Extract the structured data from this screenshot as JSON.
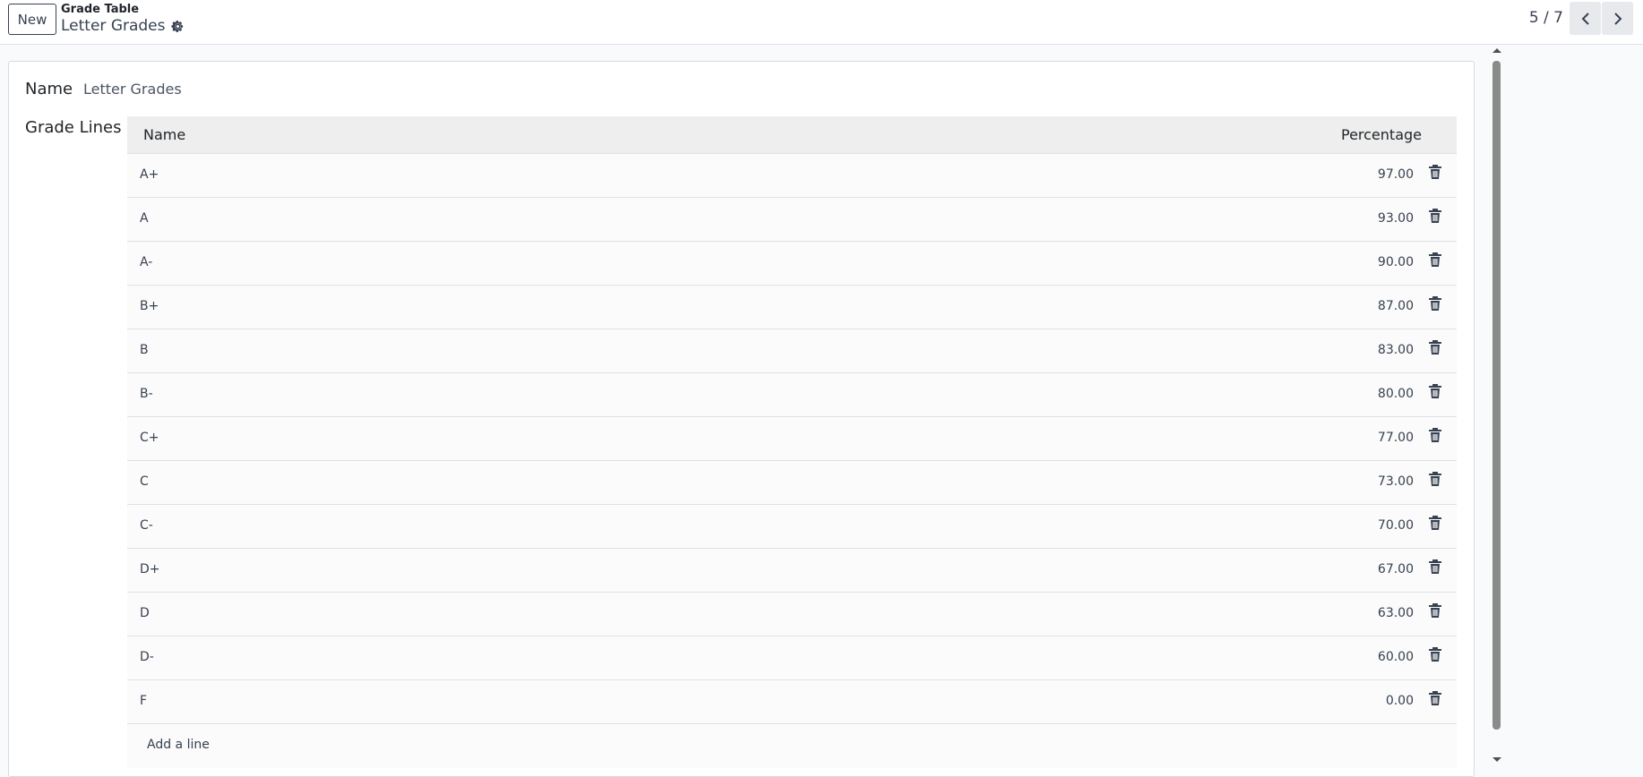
{
  "control_panel": {
    "new_label": "New",
    "breadcrumb_parent": "Grade Table",
    "breadcrumb_current": "Letter Grades",
    "pager_value": "5 / 7",
    "icons": {
      "gear": "gear-icon",
      "prev": "chevron-left-icon",
      "next": "chevron-right-icon"
    }
  },
  "form": {
    "name_label": "Name",
    "name_value": "Letter Grades",
    "grade_lines_label": "Grade Lines",
    "table": {
      "headers": {
        "name": "Name",
        "percentage": "Percentage"
      },
      "rows": [
        {
          "name": "A+",
          "percentage": "97.00"
        },
        {
          "name": "A",
          "percentage": "93.00"
        },
        {
          "name": "A-",
          "percentage": "90.00"
        },
        {
          "name": "B+",
          "percentage": "87.00"
        },
        {
          "name": "B",
          "percentage": "83.00"
        },
        {
          "name": "B-",
          "percentage": "80.00"
        },
        {
          "name": "C+",
          "percentage": "77.00"
        },
        {
          "name": "C",
          "percentage": "73.00"
        },
        {
          "name": "C-",
          "percentage": "70.00"
        },
        {
          "name": "D+",
          "percentage": "67.00"
        },
        {
          "name": "D",
          "percentage": "63.00"
        },
        {
          "name": "D-",
          "percentage": "60.00"
        },
        {
          "name": "F",
          "percentage": "0.00"
        }
      ],
      "add_line_label": "Add a line",
      "row_action_icon": "trash-icon"
    }
  }
}
